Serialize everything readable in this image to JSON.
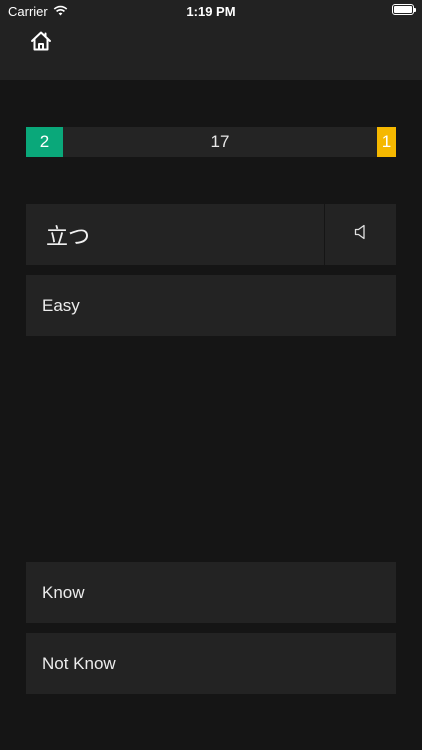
{
  "status_bar": {
    "carrier": "Carrier",
    "time": "1:19 PM"
  },
  "nav": {
    "home_icon": "home-icon"
  },
  "progress": {
    "known_count": "2",
    "remaining_count": "17",
    "unknown_count": "1",
    "colors": {
      "known": "#0aa87a",
      "unknown": "#f5b800"
    }
  },
  "card": {
    "word": "立つ",
    "speaker_icon": "speaker-icon",
    "meaning": "Easy"
  },
  "actions": {
    "know_label": "Know",
    "not_know_label": "Not Know"
  }
}
